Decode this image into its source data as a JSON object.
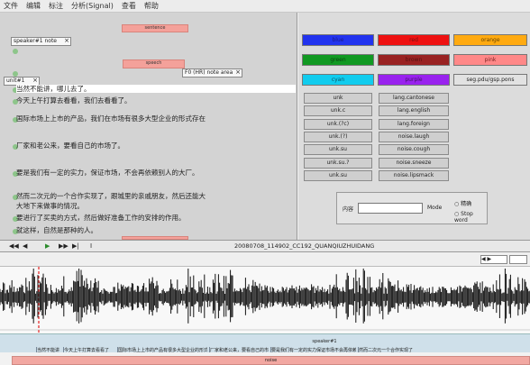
{
  "menu": [
    "文件",
    "编辑",
    "标注",
    "分析(Signal)",
    "查看",
    "帮助"
  ],
  "left": {
    "top_bar": "sentence",
    "speaker_tag": "speaker#1 note",
    "mid_bar": "speech",
    "right_tag": "F0 (HR) note area",
    "unit_tag": "unit#1",
    "lines": [
      "当然不能讲，哪儿去了。",
      "今天上午打算去看看，我们去看看了。",
      "国际市场上上市的产品，我们在市场有很多大型企业的形式存在",
      "厂家和老公来，要看自己的市场了。",
      "要是我们有一定的实力，保证市场，不会再依赖别人的大厂。",
      "然而二次元的一个合作实现了，跟城里的亲戚朋友，然后还能大",
      "大地下来做事的情况。",
      "要进行了买卖的方式，然后做好准备工作的安排的作用。",
      "就这样，自然是那种的人。"
    ],
    "bottom_bar": "sentence"
  },
  "color_buttons": [
    {
      "label": "blue",
      "color": "#2233ee",
      "text": "#1a1a88"
    },
    {
      "label": "red",
      "color": "#ee1111",
      "text": "#771111"
    },
    {
      "label": "orange",
      "color": "#ffaa11",
      "text": "#664400"
    },
    {
      "label": "green",
      "color": "#119922",
      "text": "#0b4411"
    },
    {
      "label": "brown",
      "color": "#992222",
      "text": "#551111"
    },
    {
      "label": "pink",
      "color": "#ff8888",
      "text": "#772222"
    },
    {
      "label": "cyan",
      "color": "#11ccee",
      "text": "#115566"
    },
    {
      "label": "purple",
      "color": "#9922ee",
      "text": "#441166"
    },
    {
      "label": "seg.pdu/gsp.pons",
      "color": "#e2e2e2",
      "text": "#222222"
    }
  ],
  "func_buttons": {
    "left": [
      "unk",
      "unk.c",
      "unk.(?c)",
      "unk.(?)",
      "unk.su",
      "unk.su.?",
      "unk.su"
    ],
    "right": [
      "lang.cantonese",
      "lang.english",
      "lang.foreign",
      "noise.laugh",
      "noise.cough",
      "noise.sneeze",
      "noise.lipsmack"
    ]
  },
  "search": {
    "label": "内容",
    "placeholder": "",
    "mode_label": "Mode",
    "option1": "精确",
    "option2": "Stop word"
  },
  "transport": {
    "buttons": [
      "◀◀",
      "◀",
      "▶",
      "▶▶",
      "▶|",
      "I"
    ],
    "status": "20080708_114902_CC192_QUANQIUZHUIDANG"
  },
  "tiers": {
    "tier1_label": "noise",
    "tier2_label": "speaker#1",
    "cells": [
      "当然不能讲",
      "今天上午打算去看看了",
      "国际市场上上市的产品有很多大型企业的形式存在我们在市场",
      "厂家和老公来，要看自己的市场了",
      "要是我们有一定的实力保证市场不会再依赖别人",
      "然而二次元一个合作实现了"
    ]
  }
}
